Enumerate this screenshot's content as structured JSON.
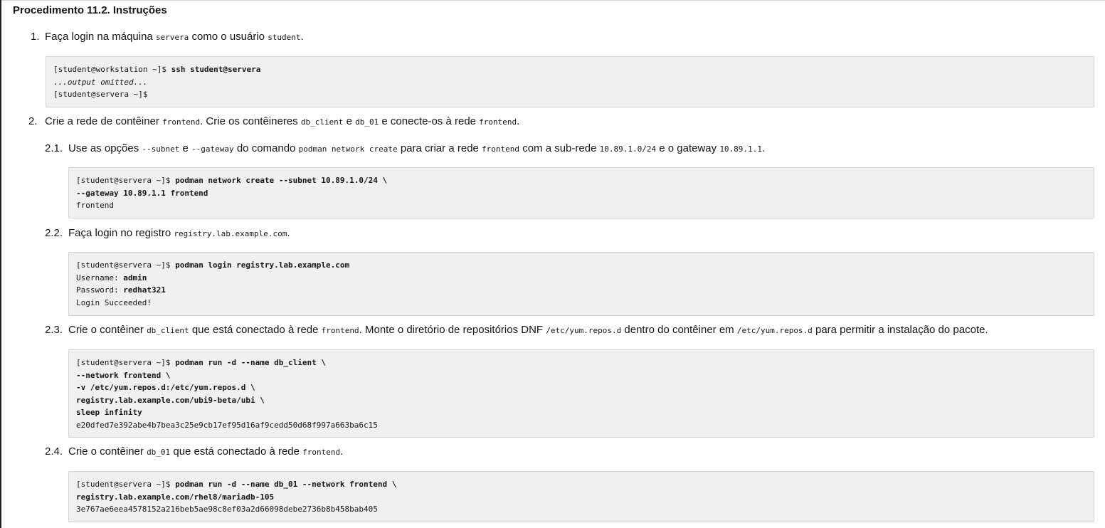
{
  "title": "Procedimento 11.2. Instruções",
  "steps": {
    "s1": {
      "num": "1.",
      "t1": "Faça login na máquina ",
      "c1": "servera",
      "t2": " como o usuário ",
      "c2": "student",
      "t3": ".",
      "code": {
        "prompt1": "[student@workstation ~]$ ",
        "cmd1": "ssh student@servera",
        "omitted": "...output omitted...",
        "prompt2": "[student@servera ~]$"
      }
    },
    "s2": {
      "num": "2.",
      "t1": "Crie a rede de contêiner ",
      "c1": "frontend",
      "t2": ". Crie os contêineres ",
      "c2": "db_client",
      "t3": " e ",
      "c3": "db_01",
      "t4": " e conecte-os à rede ",
      "c4": "frontend",
      "t5": "."
    },
    "s21": {
      "num": "2.1.",
      "t1": "Use as opções ",
      "c1": "--subnet",
      "t2": " e ",
      "c2": "--gateway",
      "t3": " do comando ",
      "c3": "podman network create",
      "t4": " para criar a rede ",
      "c4": "frontend",
      "t5": " com a sub-rede ",
      "c5": "10.89.1.0/24",
      "t6": " e o gateway ",
      "c6": "10.89.1.1",
      "t7": ".",
      "code": {
        "prompt": "[student@servera ~]$ ",
        "cmd1": "podman network create --subnet 10.89.1.0/24 \\",
        "cmd2": "--gateway 10.89.1.1 frontend",
        "out1": "frontend"
      }
    },
    "s22": {
      "num": "2.2.",
      "t1": "Faça login no registro ",
      "c1": "registry.lab.example.com",
      "t2": ".",
      "code": {
        "prompt": "[student@servera ~]$ ",
        "cmd1": "podman login registry.lab.example.com",
        "user_label": "Username: ",
        "user_val": "admin",
        "pass_label": "Password: ",
        "pass_val": "redhat321",
        "out1": "Login Succeeded!"
      }
    },
    "s23": {
      "num": "2.3.",
      "t1": "Crie o contêiner ",
      "c1": "db_client",
      "t2": " que está conectado à rede ",
      "c2": "frontend",
      "t3": ". Monte o diretório de repositórios DNF ",
      "c3": "/etc/yum.repos.d",
      "t4": " dentro do contêiner em ",
      "c4": "/etc/yum.repos.d",
      "t5": " para permitir a instalação do pacote.",
      "code": {
        "prompt": "[student@servera ~]$ ",
        "cmd1": "podman run -d --name db_client \\",
        "cmd2": "--network frontend \\",
        "cmd3": "-v /etc/yum.repos.d:/etc/yum.repos.d \\",
        "cmd4": "registry.lab.example.com/ubi9-beta/ubi \\",
        "cmd5": "sleep infinity",
        "out1": "e20dfed7e392abe4b7bea3c25e9cb17ef95d16af9cedd50d68f997a663ba6c15"
      }
    },
    "s24": {
      "num": "2.4.",
      "t1": "Crie o contêiner ",
      "c1": "db_01",
      "t2": " que está conectado à rede ",
      "c2": "frontend",
      "t3": ".",
      "code": {
        "prompt": "[student@servera ~]$ ",
        "cmd1": "podman run -d --name db_01 --network frontend \\",
        "cmd2": "registry.lab.example.com/rhel8/mariadb-105",
        "out1": "3e767ae6eea4578152a216beb5ae98c8ef03a2d66098debe2736b8b458bab405"
      }
    }
  }
}
